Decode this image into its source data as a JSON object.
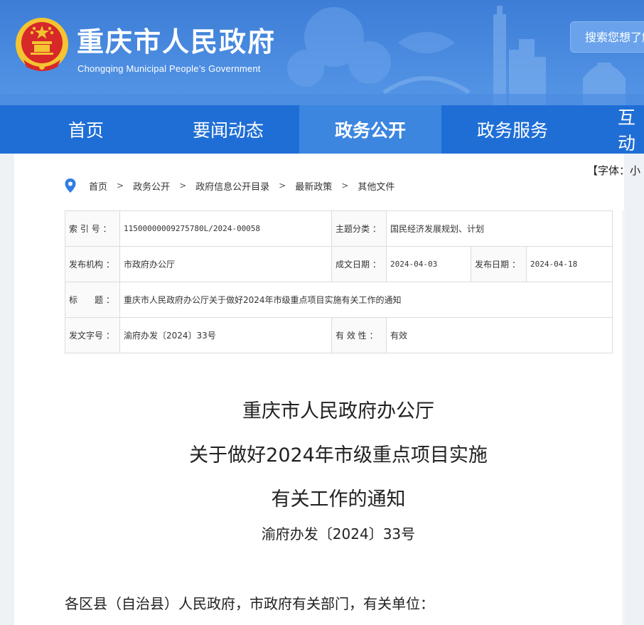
{
  "header": {
    "title": "重庆市人民政府",
    "subtitle": "Chongqing Municipal People’s Government",
    "search_placeholder": "搜索您想了解"
  },
  "nav": {
    "items": [
      {
        "label": "首页"
      },
      {
        "label": "要闻动态"
      },
      {
        "label": "政务公开",
        "active": true
      },
      {
        "label": "政务服务"
      },
      {
        "label": "互动"
      }
    ]
  },
  "toolbar": {
    "font_size_label": "【字体：小"
  },
  "breadcrumb": {
    "items": [
      "首页",
      "政务公开",
      "政府信息公开目录",
      "最新政策",
      "其他文件"
    ],
    "separator": ">"
  },
  "info": {
    "index_label": "索 引 号 ：",
    "index_value": "11500000009275780L/2024-00058",
    "topic_label": "主题分类 ：",
    "topic_value": "国民经济发展规划、计划",
    "publisher_label": "发布机构 ：",
    "publisher_value": "市政府办公厅",
    "created_label": "成文日期 ：",
    "created_value": "2024-04-03",
    "published_label": "发布日期 ：",
    "published_value": "2024-04-18",
    "subject_label": "标　　题 ：",
    "subject_value": "重庆市人民政府办公厅关于做好2024年市级重点项目实施有关工作的通知",
    "docno_label": "发文字号 ：",
    "docno_value": "渝府办发〔2024〕33号",
    "validity_label": "有 效 性 ：",
    "validity_value": "有效"
  },
  "article": {
    "title_lines": [
      "重庆市人民政府办公厅",
      "关于做好2024年市级重点项目实施",
      "有关工作的通知"
    ],
    "doc_number": "渝府办发〔2024〕33号",
    "salutation": "各区县（自治县）人民政府，市政府有关部门，有关单位："
  },
  "colors": {
    "nav_bg": "#1f6ed6",
    "nav_active_bg": "#3c86e0",
    "banner_bg": "#4a8be0",
    "emblem_red": "#d7282a",
    "emblem_gold": "#f4c431"
  }
}
